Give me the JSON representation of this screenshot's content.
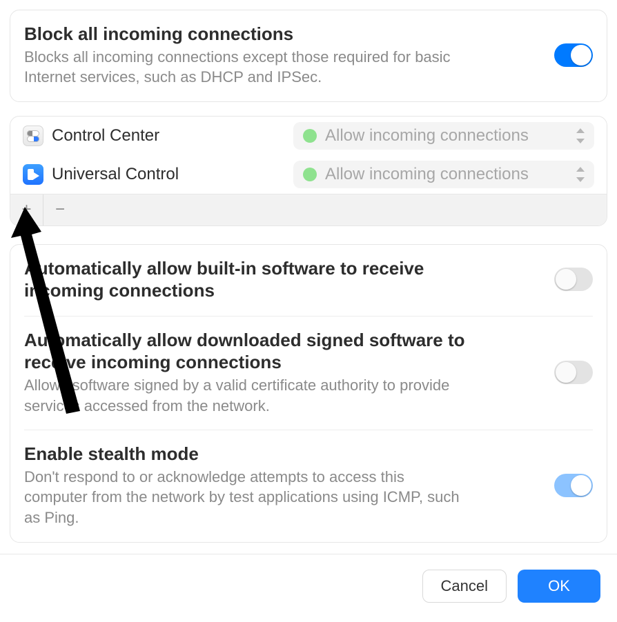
{
  "block_all": {
    "title": "Block all incoming connections",
    "desc": "Blocks all incoming connections except those required for basic Internet services, such as DHCP and IPSec.",
    "value": true
  },
  "apps": [
    {
      "name": "Control Center",
      "icon": "control-center-icon",
      "policy": "Allow incoming connections",
      "status": "allow"
    },
    {
      "name": "Universal Control",
      "icon": "universal-control-icon",
      "policy": "Allow incoming connections",
      "status": "allow"
    }
  ],
  "list_buttons": {
    "add": "+",
    "remove": "−"
  },
  "options": {
    "builtin": {
      "title": "Automatically allow built-in software to receive incoming connections",
      "value": false
    },
    "signed": {
      "title": "Automatically allow downloaded signed software to receive incoming connections",
      "desc": "Allows software signed by a valid certificate authority to provide services accessed from the network.",
      "value": false
    },
    "stealth": {
      "title": "Enable stealth mode",
      "desc": "Don't respond to or acknowledge attempts to access this computer from the network by test applications using ICMP, such as Ping.",
      "value": true
    }
  },
  "buttons": {
    "cancel": "Cancel",
    "ok": "OK"
  }
}
